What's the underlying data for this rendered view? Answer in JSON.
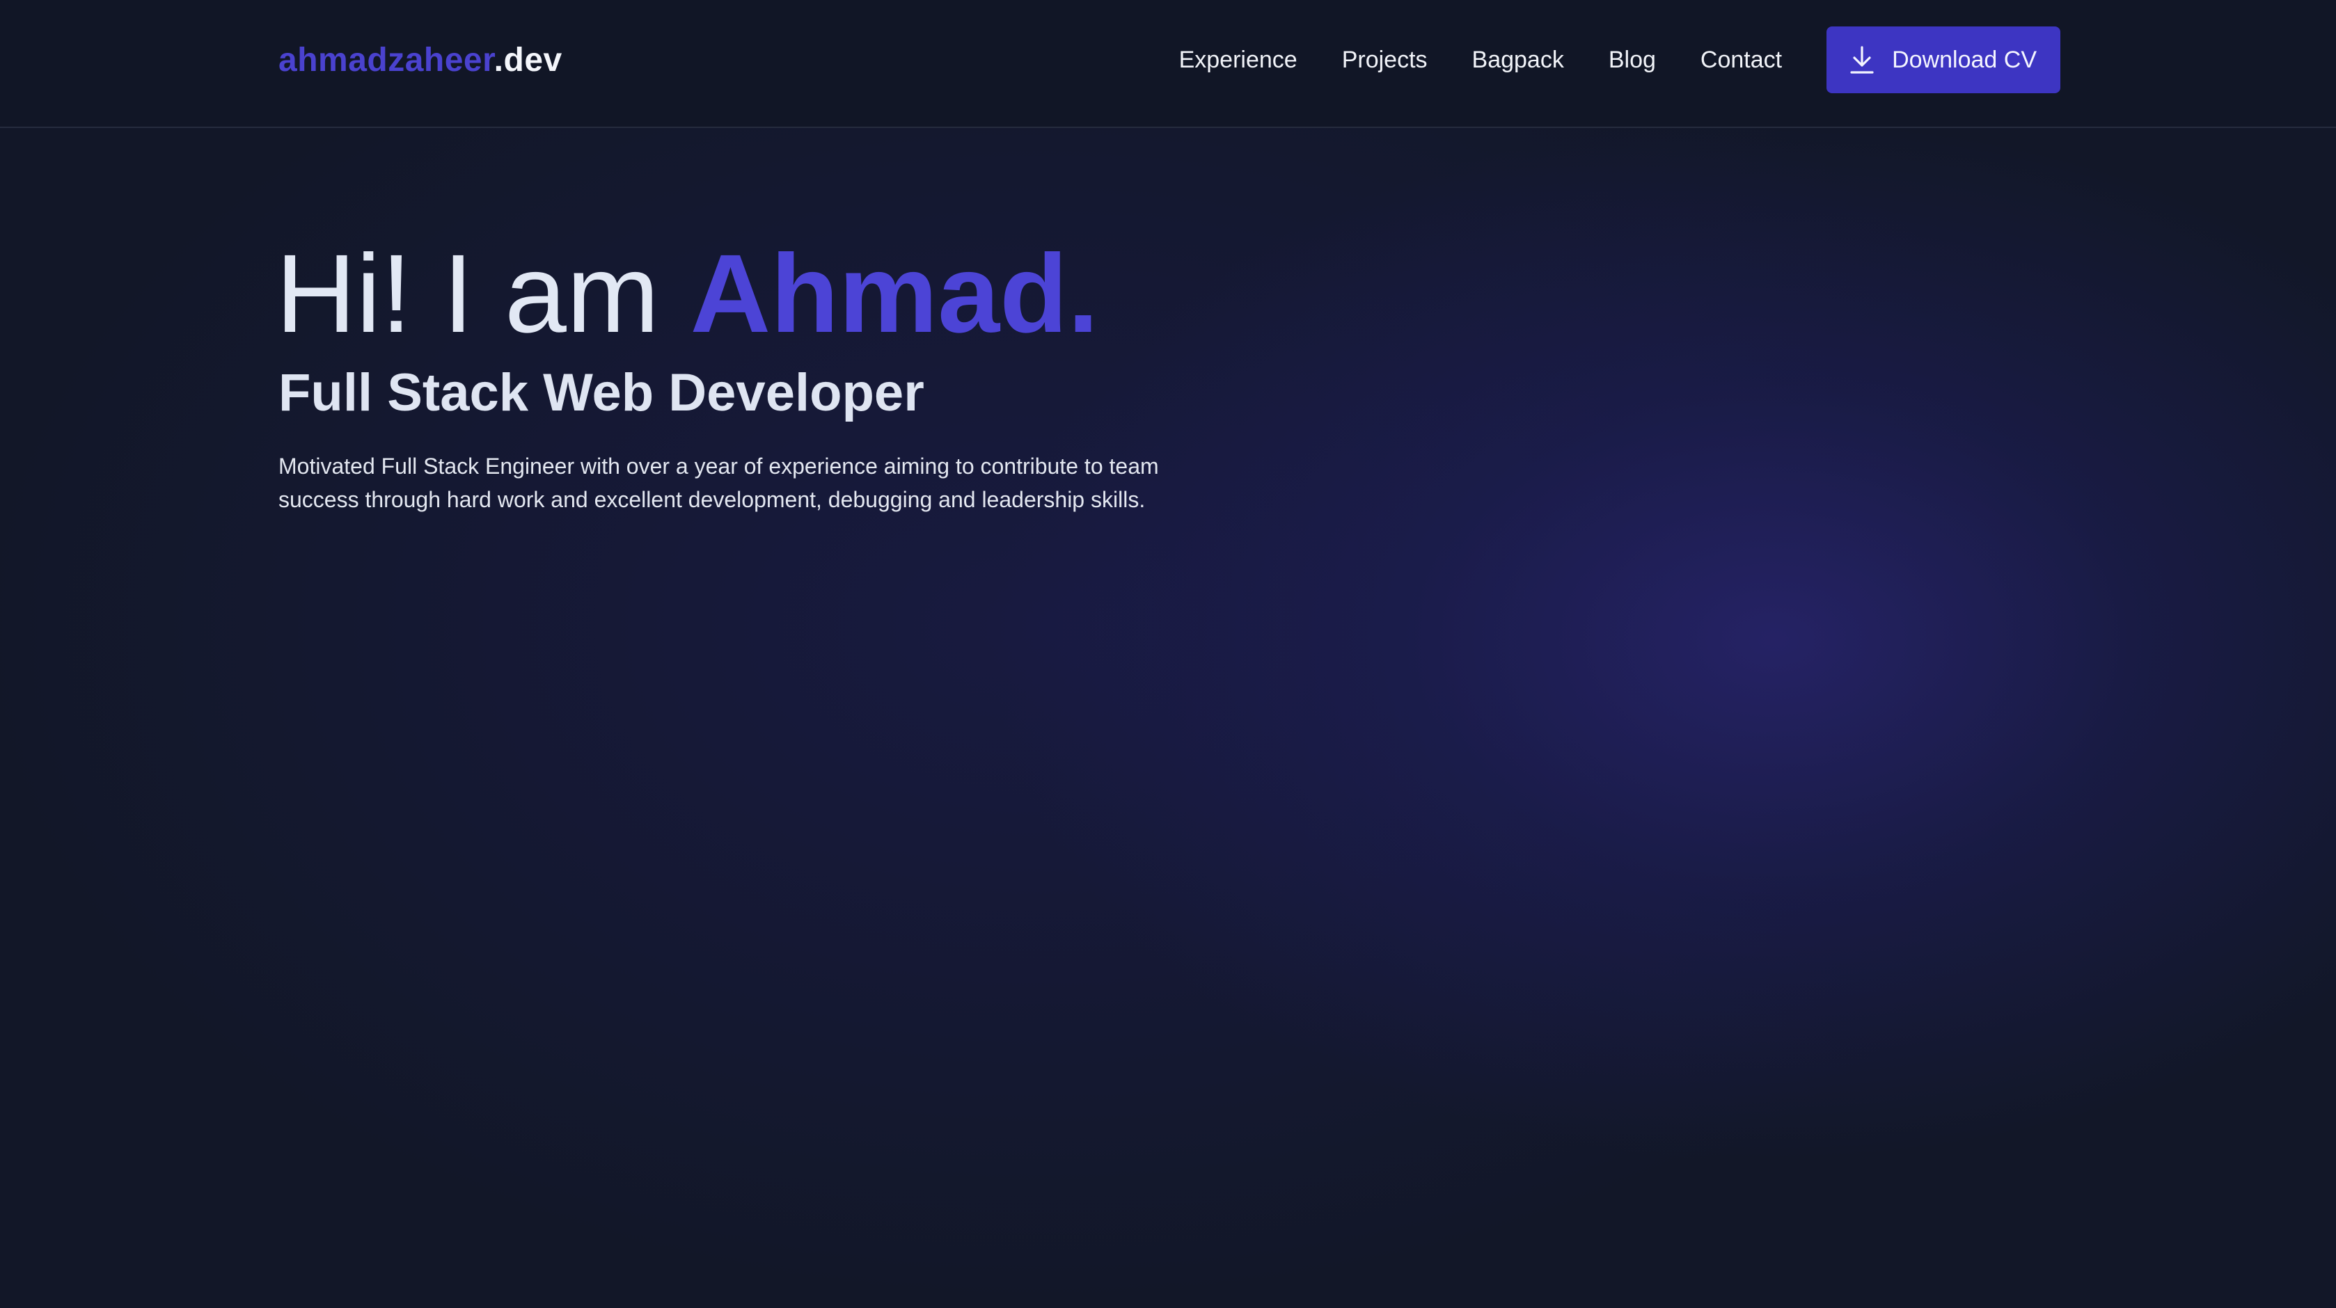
{
  "header": {
    "logo": {
      "brand": "ahmadzaheer",
      "tld": ".dev"
    },
    "nav": [
      {
        "label": "Experience"
      },
      {
        "label": "Projects"
      },
      {
        "label": "Bagpack"
      },
      {
        "label": "Blog"
      },
      {
        "label": "Contact"
      }
    ],
    "cv_button": {
      "label": "Download CV",
      "icon": "download-icon"
    }
  },
  "hero": {
    "greeting_prefix": "Hi! I am ",
    "name": "Ahmad.",
    "role": "Full Stack Web Developer",
    "intro": "Motivated Full Stack Engineer with over a year of experience aiming to contribute to team success through hard work and excellent development, debugging and leadership skills."
  },
  "colors": {
    "background": "#121728",
    "accent": "#4c44d6",
    "button": "#3d35c2",
    "text": "#e6ebf5"
  }
}
